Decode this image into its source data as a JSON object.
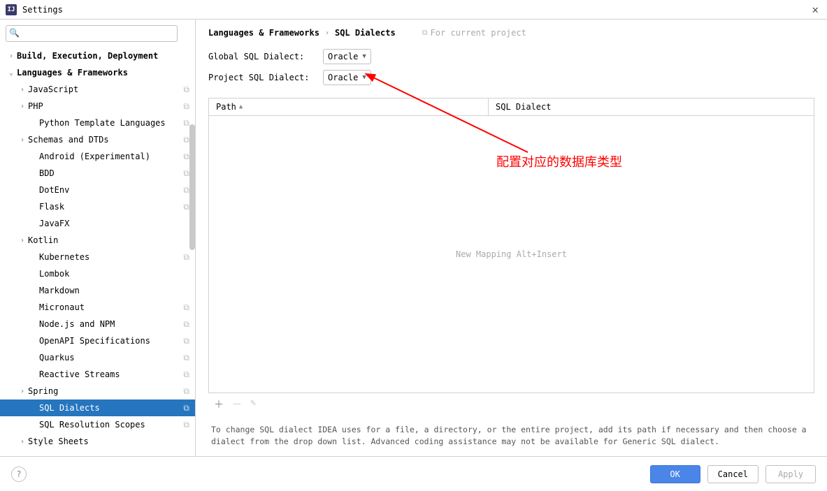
{
  "window": {
    "title": "Settings",
    "app_icon_text": "IJ"
  },
  "search": {
    "placeholder": ""
  },
  "sidebar": {
    "items": [
      {
        "label": "Build, Execution, Deployment",
        "indent": 0,
        "chevron": "right",
        "bold": true,
        "copy": false,
        "selected": false
      },
      {
        "label": "Languages & Frameworks",
        "indent": 0,
        "chevron": "down",
        "bold": true,
        "copy": false,
        "selected": false
      },
      {
        "label": "JavaScript",
        "indent": 1,
        "chevron": "right",
        "bold": false,
        "copy": true,
        "selected": false
      },
      {
        "label": "PHP",
        "indent": 1,
        "chevron": "right",
        "bold": false,
        "copy": true,
        "selected": false
      },
      {
        "label": "Python Template Languages",
        "indent": 2,
        "chevron": "",
        "bold": false,
        "copy": true,
        "selected": false
      },
      {
        "label": "Schemas and DTDs",
        "indent": 1,
        "chevron": "right",
        "bold": false,
        "copy": true,
        "selected": false
      },
      {
        "label": "Android (Experimental)",
        "indent": 2,
        "chevron": "",
        "bold": false,
        "copy": true,
        "selected": false
      },
      {
        "label": "BDD",
        "indent": 2,
        "chevron": "",
        "bold": false,
        "copy": true,
        "selected": false
      },
      {
        "label": "DotEnv",
        "indent": 2,
        "chevron": "",
        "bold": false,
        "copy": true,
        "selected": false
      },
      {
        "label": "Flask",
        "indent": 2,
        "chevron": "",
        "bold": false,
        "copy": true,
        "selected": false
      },
      {
        "label": "JavaFX",
        "indent": 2,
        "chevron": "",
        "bold": false,
        "copy": false,
        "selected": false
      },
      {
        "label": "Kotlin",
        "indent": 1,
        "chevron": "right",
        "bold": false,
        "copy": false,
        "selected": false
      },
      {
        "label": "Kubernetes",
        "indent": 2,
        "chevron": "",
        "bold": false,
        "copy": true,
        "selected": false
      },
      {
        "label": "Lombok",
        "indent": 2,
        "chevron": "",
        "bold": false,
        "copy": false,
        "selected": false
      },
      {
        "label": "Markdown",
        "indent": 2,
        "chevron": "",
        "bold": false,
        "copy": false,
        "selected": false
      },
      {
        "label": "Micronaut",
        "indent": 2,
        "chevron": "",
        "bold": false,
        "copy": true,
        "selected": false
      },
      {
        "label": "Node.js and NPM",
        "indent": 2,
        "chevron": "",
        "bold": false,
        "copy": true,
        "selected": false
      },
      {
        "label": "OpenAPI Specifications",
        "indent": 2,
        "chevron": "",
        "bold": false,
        "copy": true,
        "selected": false
      },
      {
        "label": "Quarkus",
        "indent": 2,
        "chevron": "",
        "bold": false,
        "copy": true,
        "selected": false
      },
      {
        "label": "Reactive Streams",
        "indent": 2,
        "chevron": "",
        "bold": false,
        "copy": true,
        "selected": false
      },
      {
        "label": "Spring",
        "indent": 1,
        "chevron": "right",
        "bold": false,
        "copy": true,
        "selected": false
      },
      {
        "label": "SQL Dialects",
        "indent": 2,
        "chevron": "",
        "bold": false,
        "copy": true,
        "selected": true
      },
      {
        "label": "SQL Resolution Scopes",
        "indent": 2,
        "chevron": "",
        "bold": false,
        "copy": true,
        "selected": false
      },
      {
        "label": "Style Sheets",
        "indent": 1,
        "chevron": "right",
        "bold": false,
        "copy": false,
        "selected": false
      }
    ]
  },
  "breadcrumb": {
    "root": "Languages & Frameworks",
    "leaf": "SQL Dialects",
    "project_hint": "For current project"
  },
  "form": {
    "global_label": "Global SQL Dialect:",
    "global_value": "Oracle",
    "project_label": "Project SQL Dialect:",
    "project_value": "Oracle"
  },
  "table": {
    "col_path": "Path",
    "col_dialect": "SQL Dialect",
    "empty_text": "New Mapping Alt+Insert"
  },
  "hint": "To change SQL dialect IDEA uses for a file, a directory, or the entire project, add its path if necessary and then choose a dialect from the drop down list. Advanced coding assistance may not be available for Generic SQL dialect.",
  "annotation": {
    "text": "配置对应的数据库类型"
  },
  "footer": {
    "ok": "OK",
    "cancel": "Cancel",
    "apply": "Apply"
  }
}
